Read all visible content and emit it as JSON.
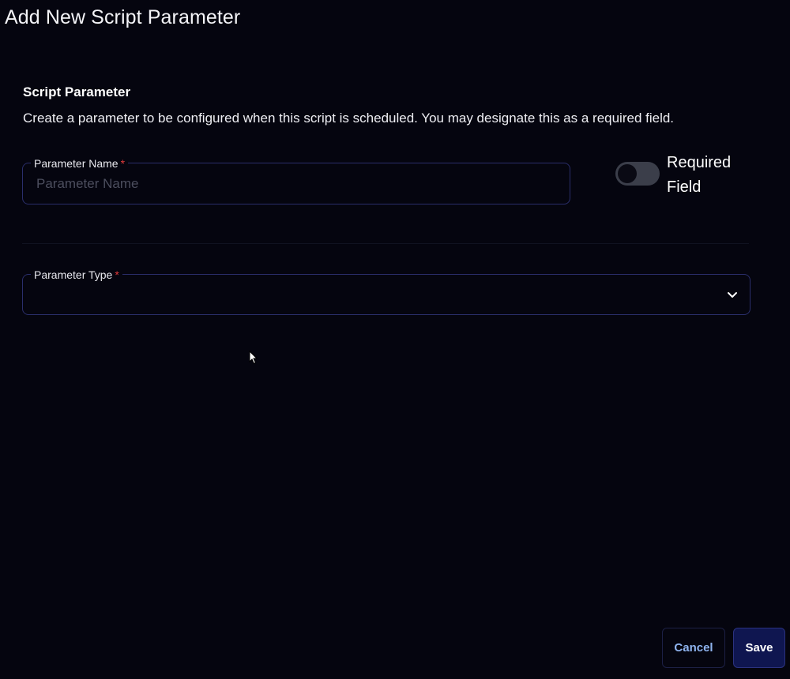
{
  "dialog": {
    "title": "Add New Script Parameter"
  },
  "section": {
    "heading": "Script Parameter",
    "description": "Create a parameter to be configured when this script is scheduled. You may designate this as a required field."
  },
  "parameter_name": {
    "label": "Parameter Name",
    "required_marker": "*",
    "value": "",
    "placeholder": "Parameter Name"
  },
  "required_toggle": {
    "label": "Required Field",
    "checked": false
  },
  "parameter_type": {
    "label": "Parameter Type",
    "required_marker": "*",
    "selected_value": "",
    "icon": "chevron-down-icon"
  },
  "actions": {
    "cancel_label": "Cancel",
    "save_label": "Save"
  },
  "colors": {
    "background": "#05050f",
    "field_border": "#2a2e6b",
    "required_star": "#e23b3b",
    "cancel_text": "#8fb4ef",
    "save_background": "#0f1650"
  }
}
